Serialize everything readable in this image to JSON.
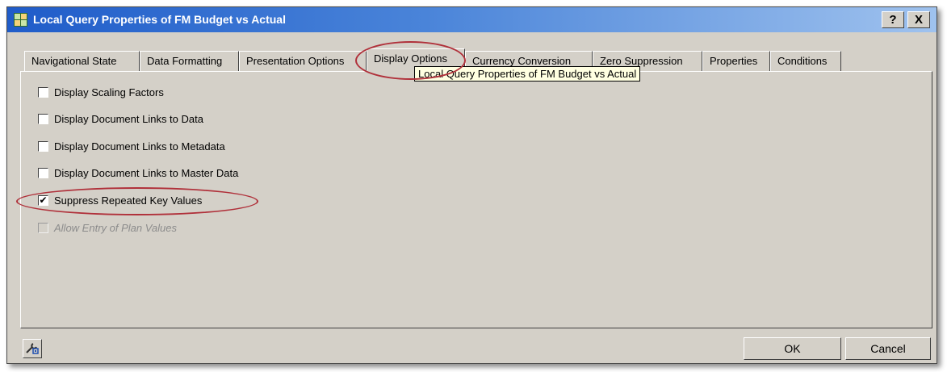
{
  "window": {
    "title": "Local Query Properties of FM Budget vs Actual",
    "help_label": "?",
    "close_label": "X"
  },
  "tabs": [
    {
      "label": "Navigational State"
    },
    {
      "label": "Data Formatting"
    },
    {
      "label": "Presentation Options"
    },
    {
      "label": "Display Options",
      "active": true
    },
    {
      "label": "Currency Conversion"
    },
    {
      "label": "Zero Suppression"
    },
    {
      "label": "Properties"
    },
    {
      "label": "Conditions"
    }
  ],
  "tooltip": "Local Query Properties of FM Budget vs Actual",
  "options": [
    {
      "label": "Display Scaling Factors",
      "checked": false,
      "enabled": true
    },
    {
      "label": "Display Document Links to Data",
      "checked": false,
      "enabled": true
    },
    {
      "label": "Display Document Links to Metadata",
      "checked": false,
      "enabled": true
    },
    {
      "label": "Display Document Links to Master Data",
      "checked": false,
      "enabled": true
    },
    {
      "label": "Suppress Repeated Key Values",
      "checked": true,
      "enabled": true
    },
    {
      "label": "Allow Entry of Plan Values",
      "checked": false,
      "enabled": false
    }
  ],
  "buttons": {
    "ok": "OK",
    "cancel": "Cancel"
  },
  "icons": {
    "title": "query-properties-icon",
    "tools": "wrench-tools-icon"
  },
  "colors": {
    "titlebar": "#1f5cc9",
    "dialog": "#d4d0c8",
    "annotation": "#b0303a",
    "tooltip": "#ffffe1"
  }
}
